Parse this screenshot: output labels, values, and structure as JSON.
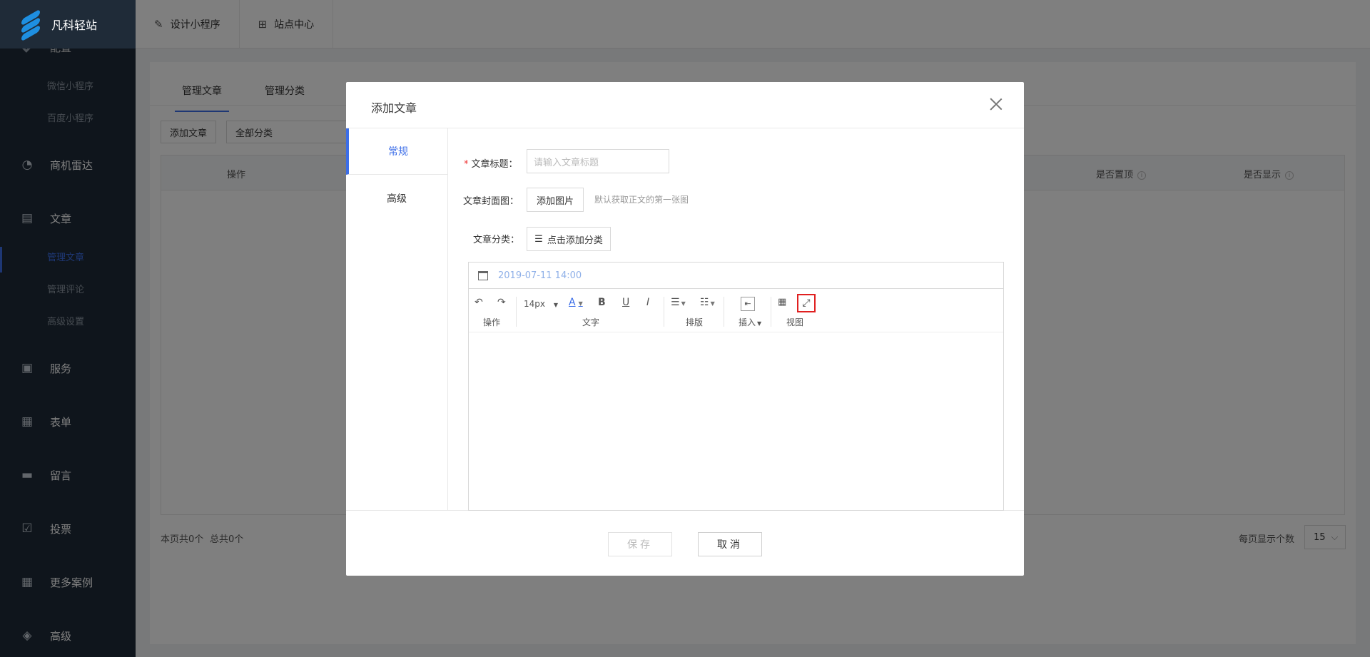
{
  "app": {
    "name": "凡科轻站"
  },
  "sidebar": {
    "partial_item": "配置",
    "sub_items_top": [
      "微信小程序",
      "百度小程序"
    ],
    "items": [
      {
        "label": "商机雷达",
        "icon": "radar-icon"
      },
      {
        "label": "文章",
        "icon": "document-icon"
      },
      {
        "label": "服务",
        "icon": "service-icon"
      },
      {
        "label": "表单",
        "icon": "form-icon"
      },
      {
        "label": "留言",
        "icon": "message-icon"
      },
      {
        "label": "投票",
        "icon": "vote-icon"
      },
      {
        "label": "更多案例",
        "icon": "grid-icon"
      },
      {
        "label": "高级",
        "icon": "apps-icon"
      }
    ],
    "article_sub": [
      "管理文章",
      "管理评论",
      "高级设置"
    ]
  },
  "topbar": {
    "tabs": [
      {
        "label": "设计小程序",
        "icon": "edit-icon"
      },
      {
        "label": "站点中心",
        "icon": "grid-icon"
      }
    ]
  },
  "main": {
    "tabs": [
      "管理文章",
      "管理分类"
    ],
    "add_button": "添加文章",
    "category_select": "全部分类",
    "columns": [
      "操作",
      "是否置顶",
      "是否显示"
    ],
    "footer": {
      "page_count": "本页共0个",
      "total_count": "总共0个",
      "per_page_label": "每页显示个数",
      "per_page_value": "15"
    }
  },
  "modal": {
    "title": "添加文章",
    "side_tabs": [
      "常规",
      "高级"
    ],
    "fields": {
      "title_label": "文章标题：",
      "title_placeholder": "请输入文章标题",
      "cover_label": "文章封面图：",
      "cover_button": "添加图片",
      "cover_hint": "默认获取正文的第一张图",
      "category_label": "文章分类：",
      "category_button": "点击添加分类"
    },
    "editor": {
      "date": "2019-07-11 14:00",
      "font_size": "14px",
      "groups": [
        "操作",
        "文字",
        "排版",
        "插入",
        "视图"
      ]
    },
    "buttons": {
      "save": "保存",
      "cancel": "取消"
    }
  },
  "colors": {
    "accent": "#3c6ee8",
    "sidebar_bg": "#1f2b38",
    "highlight": "#e02020"
  }
}
